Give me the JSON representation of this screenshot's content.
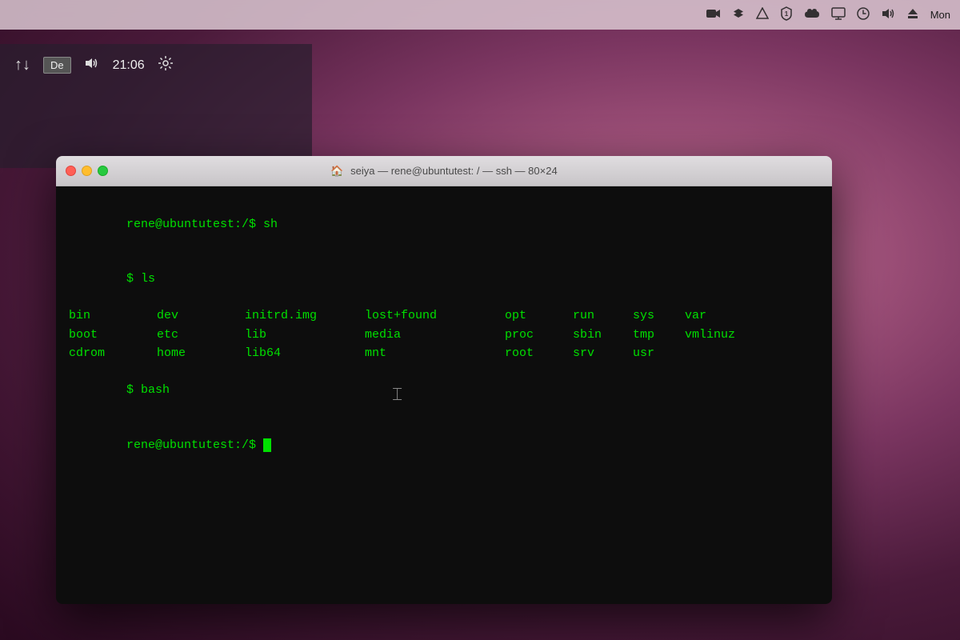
{
  "desktop": {
    "menubar": {
      "time": "Mon",
      "icons": [
        {
          "name": "facetime-camera-icon",
          "symbol": "📷"
        },
        {
          "name": "dropbox-icon",
          "symbol": "🗂"
        },
        {
          "name": "google-drive-icon",
          "symbol": "△"
        },
        {
          "name": "1password-icon",
          "symbol": "🔑"
        },
        {
          "name": "icloud-icon",
          "symbol": "☁"
        },
        {
          "name": "display-icon",
          "symbol": "🖥"
        },
        {
          "name": "time-machine-icon",
          "symbol": "🕐"
        },
        {
          "name": "volume-icon",
          "symbol": "🔊"
        },
        {
          "name": "eject-icon",
          "symbol": "⏏"
        }
      ]
    }
  },
  "linux_panel": {
    "sort_icon": "↑↓",
    "keyboard_label": "De",
    "volume_icon": "🔊",
    "time": "21:06",
    "settings_icon": "⚙"
  },
  "terminal": {
    "title": "seiya — rene@ubuntutest: / — ssh — 80×24",
    "title_icon": "🏠",
    "lines": [
      {
        "type": "prompt_cmd",
        "prompt": "rene@ubuntutest:/$ ",
        "cmd": "sh"
      },
      {
        "type": "prompt_cmd",
        "prompt": "$ ",
        "cmd": "ls"
      },
      {
        "type": "ls_row1",
        "cols": [
          "bin",
          "dev",
          "initrd.img",
          "lost+found",
          "opt",
          "run",
          "sys",
          "var",
          ""
        ]
      },
      {
        "type": "ls_row2",
        "cols": [
          "boot",
          "etc",
          "lib",
          "",
          "media",
          "",
          "proc",
          "sbin",
          "tmp",
          "vmlinuz"
        ]
      },
      {
        "type": "ls_row3",
        "cols": [
          "cdrom",
          "home",
          "lib64",
          "",
          "mnt",
          "",
          "root",
          "srv",
          "usr",
          ""
        ]
      },
      {
        "type": "prompt_cmd",
        "prompt": "$ ",
        "cmd": "bash"
      },
      {
        "type": "prompt_cursor",
        "prompt": "rene@ubuntutest:/$ "
      }
    ],
    "ls_row1": [
      "bin",
      "dev",
      "initrd.img",
      "lost+found",
      "opt",
      "run",
      "sys",
      "var"
    ],
    "ls_row2": [
      "boot",
      "etc",
      "lib",
      "media",
      "proc",
      "sbin",
      "tmp",
      "vmlinuz"
    ],
    "ls_row3": [
      "cdrom",
      "home",
      "lib64",
      "mnt",
      "root",
      "srv",
      "usr"
    ]
  }
}
